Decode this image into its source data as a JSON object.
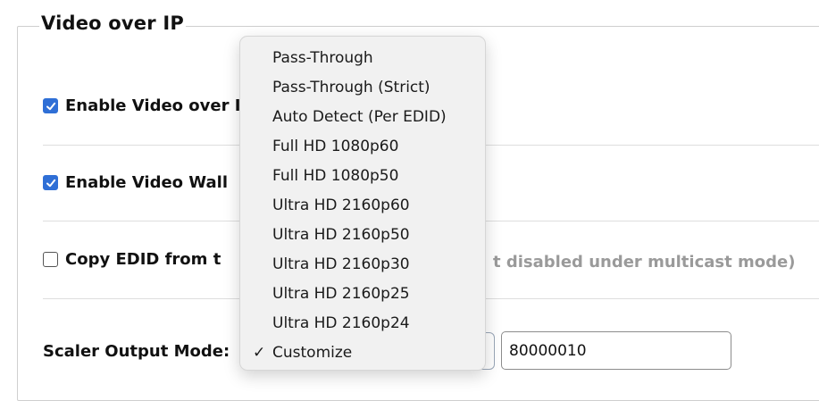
{
  "section": {
    "title": "Video over IP"
  },
  "rows": {
    "enable_video": {
      "label": "Enable Video over IP",
      "checked": true
    },
    "enable_wall": {
      "label": "Enable Video Wall",
      "checked": true
    },
    "copy_edid": {
      "label": "Copy EDID from t",
      "checked": false,
      "note_visible": "t disabled under multicast mode)"
    }
  },
  "scaler": {
    "label": "Scaler Output Mode:",
    "selected": "Customize",
    "custom_value": "80000010"
  },
  "dropdown": {
    "options": [
      "Pass-Through",
      "Pass-Through (Strict)",
      "Auto Detect (Per EDID)",
      "Full HD 1080p60",
      "Full HD 1080p50",
      "Ultra HD 2160p60",
      "Ultra HD 2160p50",
      "Ultra HD 2160p30",
      "Ultra HD 2160p25",
      "Ultra HD 2160p24",
      "Customize"
    ],
    "checkmark": "✓"
  },
  "colors": {
    "accent": "#2f6fd6",
    "disabled_text": "#9a9a9a"
  }
}
